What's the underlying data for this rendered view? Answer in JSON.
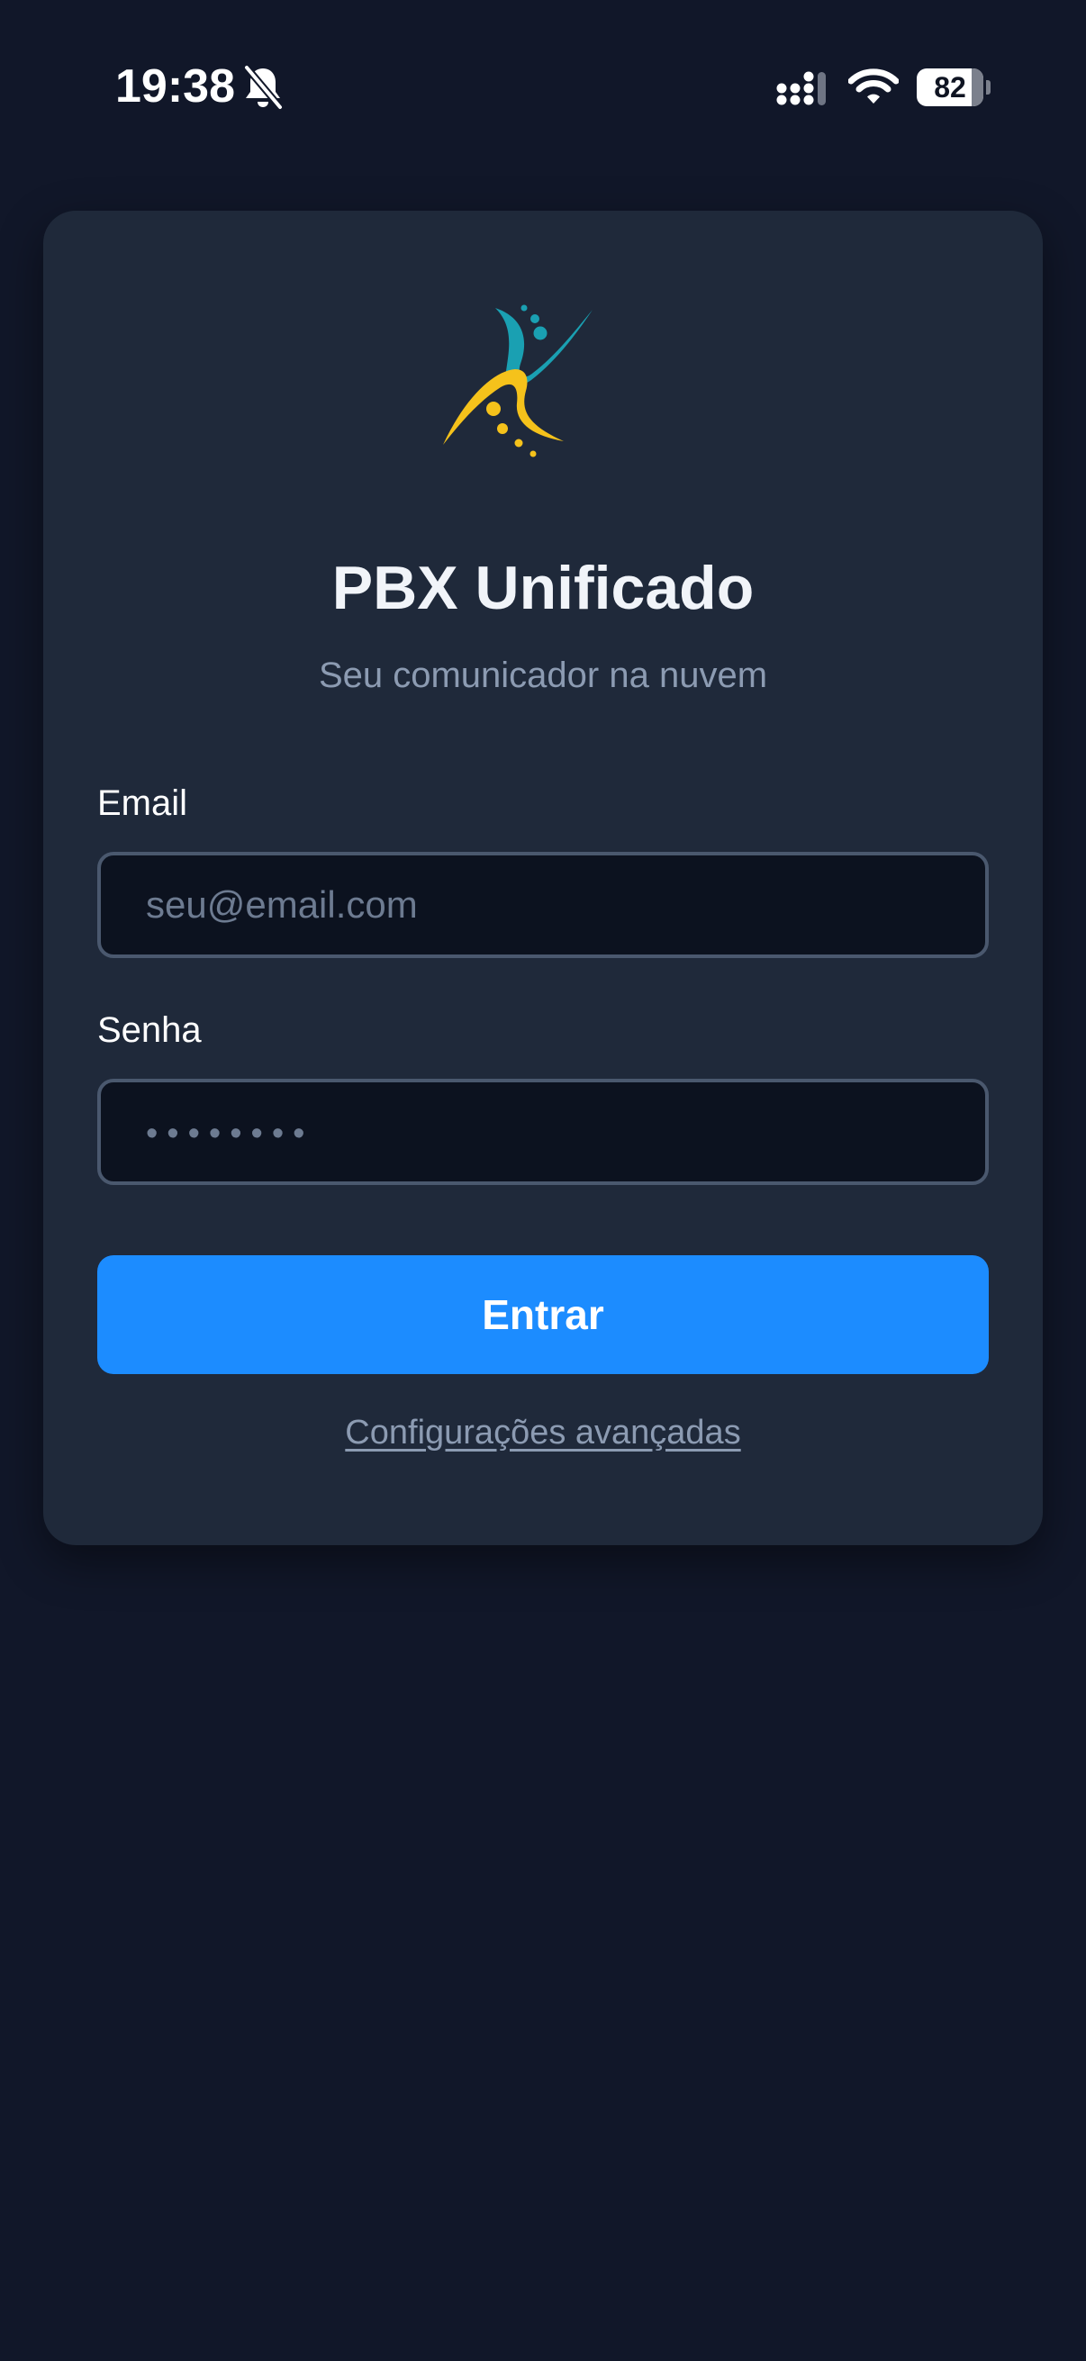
{
  "status_bar": {
    "time": "19:38",
    "battery_level": "82",
    "icons": [
      "bell-off-icon",
      "signal-icon",
      "wifi-icon",
      "battery-icon"
    ]
  },
  "app": {
    "logo_icon": "pbx-logo-icon",
    "title": "PBX Unificado",
    "subtitle": "Seu comunicador na nuvem"
  },
  "login_form": {
    "email_label": "Email",
    "email_placeholder": "seu@email.com",
    "password_label": "Senha",
    "password_placeholder": "••••••••",
    "submit_label": "Entrar",
    "advanced_link": "Configurações avançadas"
  },
  "colors": {
    "background": "#111729",
    "card": "#1f293a",
    "input_background": "#0c121f",
    "input_border": "#4a586e",
    "primary_button": "#1c8cff",
    "muted_text": "#8c9bb2",
    "logo_yellow": "#f5c21b",
    "logo_teal": "#1aa0b2"
  }
}
